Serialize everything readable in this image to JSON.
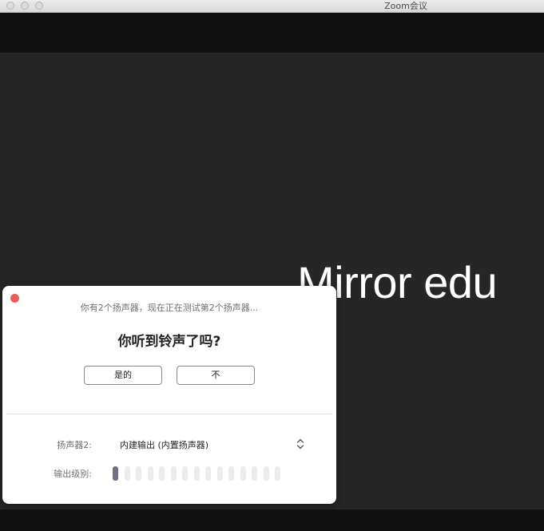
{
  "window": {
    "title": "Zoom会议"
  },
  "video": {
    "participant_name": "Mirror edu"
  },
  "dialog": {
    "message": "你有2个扬声器，现在正在测试第2个扬声器...",
    "question": "你听到铃声了吗?",
    "yes_label": "是的",
    "no_label": "不",
    "speaker_label": "扬声器2:",
    "speaker_value": "内建输出 (内置扬声器)",
    "level_label": "输出级别:",
    "output_level": {
      "segments_total": 15,
      "segments_active": 1
    }
  },
  "colors": {
    "close_button": "#ec5d57",
    "meter_active": "#717185",
    "meter_inactive": "#ececec"
  },
  "icons": {
    "speaker_select": "updown-chevron-icon"
  }
}
